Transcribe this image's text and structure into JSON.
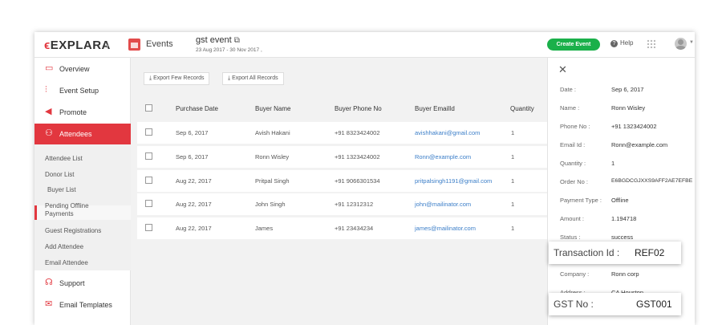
{
  "header": {
    "logo_text": "EXPLARA",
    "section_label": "Events",
    "event_title": "gst event",
    "event_dates": "23 Aug 2017 - 30 Nov 2017 ,",
    "create_button": "Create Event",
    "help_label": "Help"
  },
  "sidebar": {
    "items": [
      {
        "label": "Overview",
        "icon": "monitor-icon"
      },
      {
        "label": "Event Setup",
        "icon": "sliders-icon"
      },
      {
        "label": "Promote",
        "icon": "megaphone-icon"
      },
      {
        "label": "Attendees",
        "icon": "users-icon",
        "active": true
      }
    ],
    "sub_items": [
      "Attendee List",
      "Donor List",
      "Buyer List",
      "Pending Offline Payments",
      "Guest Registrations",
      "Add Attendee",
      "Email Attendee"
    ],
    "active_sub_item": "Buyer List",
    "bottom_items": [
      {
        "label": "Support",
        "icon": "headset-icon"
      },
      {
        "label": "Email Templates",
        "icon": "envelope-icon"
      }
    ]
  },
  "toolbar": {
    "export_few": "Export Few Records",
    "export_all": "Export All Records"
  },
  "table": {
    "columns": [
      "Purchase Date",
      "Buyer Name",
      "Buyer Phone No",
      "Buyer EmailId",
      "Quantity"
    ],
    "rows": [
      {
        "date": "Sep 6, 2017",
        "name": "Avish Hakani",
        "phone": "+91 8323424002",
        "email": "avishhakani@gmail.com",
        "qty": "1"
      },
      {
        "date": "Sep 6, 2017",
        "name": "Ronn Wisley",
        "phone": "+91 1323424002",
        "email": "Ronn@example.com",
        "qty": "1"
      },
      {
        "date": "Aug 22, 2017",
        "name": "Pritpal Singh",
        "phone": "+91 9066301534",
        "email": "pritpalsingh1191@gmail.com",
        "qty": "1"
      },
      {
        "date": "Aug 22, 2017",
        "name": "John Singh",
        "phone": "+91 12312312",
        "email": "john@mailinator.com",
        "qty": "1"
      },
      {
        "date": "Aug 22, 2017",
        "name": "James",
        "phone": "+91 23434234",
        "email": "james@mailinator.com",
        "qty": "1"
      }
    ]
  },
  "details": {
    "fields": [
      {
        "key": "Date :",
        "value": "Sep 6, 2017"
      },
      {
        "key": "Name :",
        "value": "Ronn Wisley"
      },
      {
        "key": "Phone No :",
        "value": "+91 1323424002"
      },
      {
        "key": "Email Id :",
        "value": "Ronn@example.com"
      },
      {
        "key": "Quantity :",
        "value": "1"
      },
      {
        "key": "Order No :",
        "value": "E6BGDCGJXXS9AFF2AE7EFBE"
      },
      {
        "key": "Payment Type :",
        "value": "Offline"
      },
      {
        "key": "Amount :",
        "value": "1.194718"
      },
      {
        "key": "Status :",
        "value": "success"
      },
      {
        "key": "Company :",
        "value": "Ronn corp"
      },
      {
        "key": "Address :",
        "value": "CA Houston"
      }
    ],
    "transaction_label": "Transaction Id :",
    "transaction_value": "REF02",
    "gst_label": "GST No :",
    "gst_value": "GST001"
  },
  "colors": {
    "brand_red": "#e2373f",
    "create_green": "#1ab04a",
    "link_blue": "#3b7ec8"
  }
}
